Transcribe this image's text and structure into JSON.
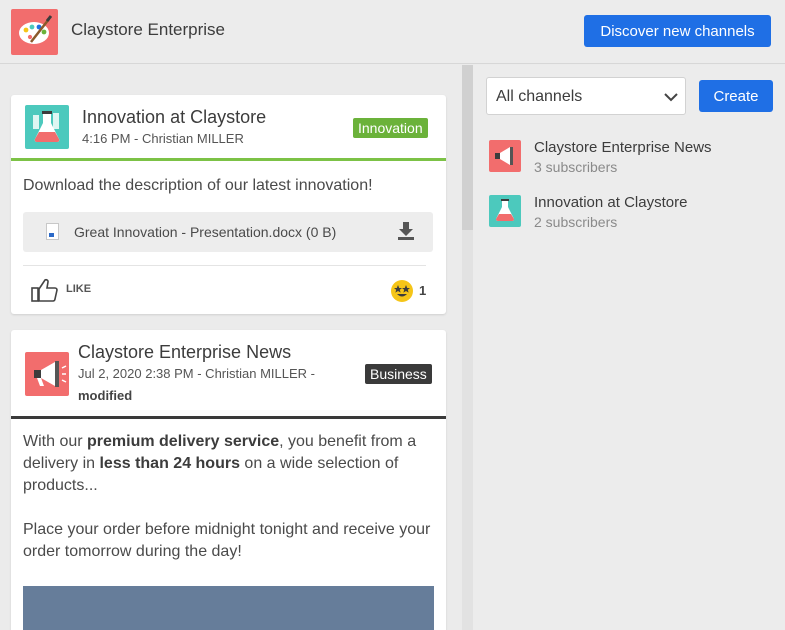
{
  "header": {
    "app_title": "Claystore Enterprise",
    "discover_label": "Discover new channels"
  },
  "posts": [
    {
      "channel": "Innovation at Claystore",
      "meta": "4:16 PM - Christian MILLER",
      "tag": "Innovation",
      "text": "Download the description of our latest innovation!",
      "attachment": "Great Innovation - Presentation.docx  (0 B)",
      "like_label": "LIKE",
      "reaction_count": "1"
    },
    {
      "channel": "Claystore Enterprise News",
      "meta_line1": "Jul 2, 2020 2:38 PM - Christian MILLER -",
      "meta_line2": "modified",
      "tag": "Business",
      "text": {
        "p1_a": "With our ",
        "p1_b": "premium delivery service",
        "p1_c": ", you benefit from a delivery in ",
        "p1_d": "less than 24 hours",
        "p1_e": " on a wide selection of products...",
        "p2": "Place your order before midnight tonight and receive your order tomorrow during the day!"
      }
    }
  ],
  "sidebar": {
    "filter_value": "All channels",
    "create_label": "Create",
    "channels": [
      {
        "name": "Claystore Enterprise News",
        "subscribers": "3 subscribers",
        "icon": "megaphone-icon"
      },
      {
        "name": "Innovation at Claystore",
        "subscribers": "2 subscribers",
        "icon": "flask-icon"
      }
    ]
  },
  "colors": {
    "primary": "#1f6fe5",
    "innovation": "#6bb23a",
    "business": "#3a3a3a",
    "flask_bg": "#4cc9bd",
    "mega_bg": "#f26d6d"
  }
}
